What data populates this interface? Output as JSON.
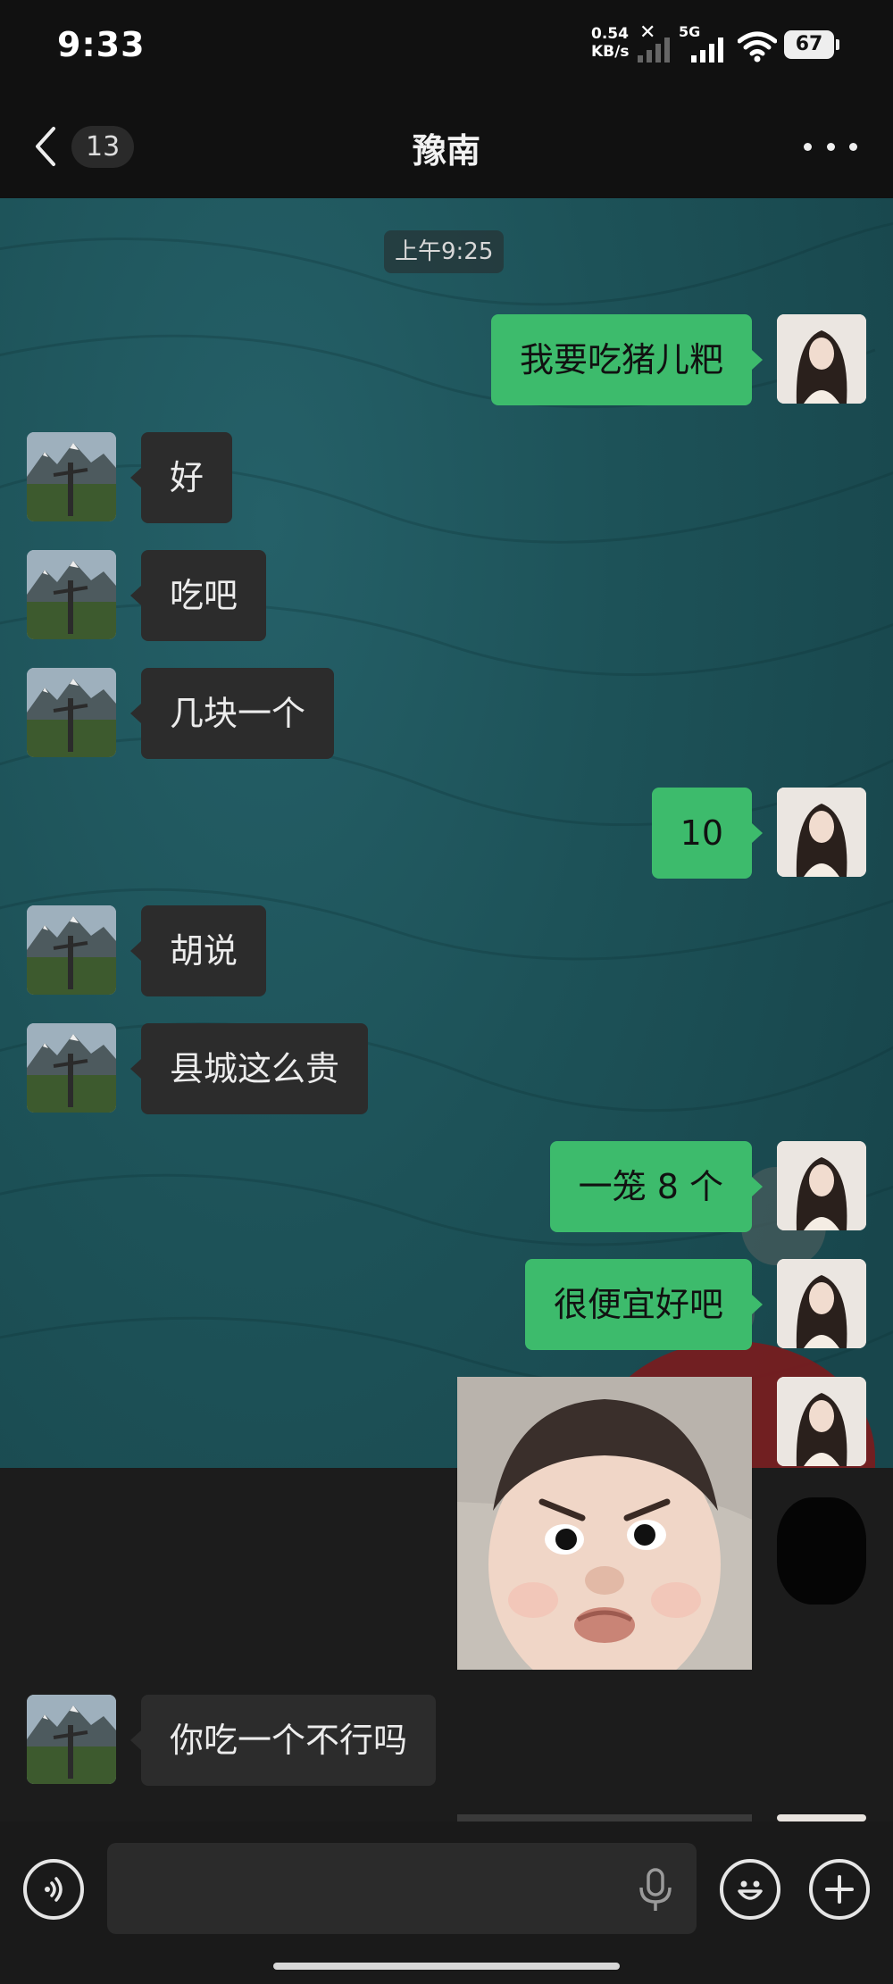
{
  "status_bar": {
    "time": "9:33",
    "net_speed_value": "0.54",
    "net_speed_unit": "KB/s",
    "network": "5G",
    "battery": "67"
  },
  "nav": {
    "unread_count": "13",
    "title": "豫南"
  },
  "chat": {
    "timestamp": "上午9:25",
    "messages": [
      {
        "side": "out",
        "text": "我要吃猪儿粑"
      },
      {
        "side": "in",
        "text": "好"
      },
      {
        "side": "in",
        "text": "吃吧"
      },
      {
        "side": "in",
        "text": "几块一个"
      },
      {
        "side": "out",
        "text": "10"
      },
      {
        "side": "in",
        "text": "胡说"
      },
      {
        "side": "in",
        "text": "县城这么贵"
      },
      {
        "side": "out",
        "text": "一笼 8 个"
      },
      {
        "side": "out",
        "text": "很便宜好吧"
      },
      {
        "side": "out",
        "type": "sticker",
        "icon": "angry-baby-sticker"
      },
      {
        "side": "in",
        "text": "你吃一个不行吗"
      }
    ]
  },
  "input_bar": {
    "placeholder": "",
    "icons": [
      "voice-icon",
      "mic-icon",
      "emoji-icon",
      "plus-icon"
    ]
  },
  "colors": {
    "out_bubble": "#3dbb6c",
    "in_bubble": "#2c2c2c",
    "chat_bg": "#1d5258"
  }
}
